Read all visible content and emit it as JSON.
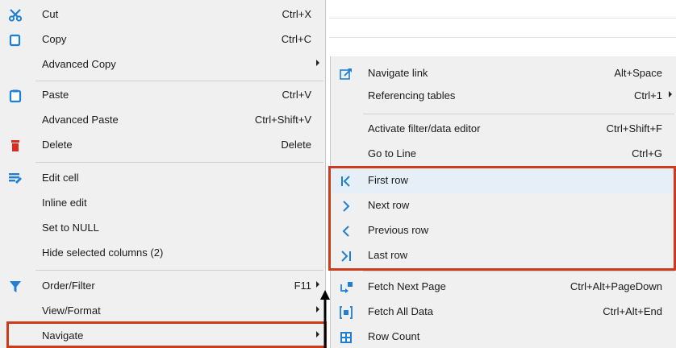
{
  "context_menu": {
    "items": [
      {
        "label": "Cut",
        "shortcut": "Ctrl+X",
        "icon": "scissors-icon"
      },
      {
        "label": "Copy",
        "shortcut": "Ctrl+C",
        "icon": "copy-icon"
      },
      {
        "label": "Advanced Copy",
        "shortcut": "",
        "icon": "",
        "submenu": true
      },
      {
        "label": "Paste",
        "shortcut": "Ctrl+V",
        "icon": "clipboard-icon"
      },
      {
        "label": "Advanced Paste",
        "shortcut": "Ctrl+Shift+V",
        "icon": ""
      },
      {
        "label": "Delete",
        "shortcut": "Delete",
        "icon": "trash-icon"
      },
      {
        "label": "Edit cell",
        "shortcut": "",
        "icon": "edit-cell-icon"
      },
      {
        "label": "Inline edit",
        "shortcut": "",
        "icon": ""
      },
      {
        "label": "Set to NULL",
        "shortcut": "",
        "icon": ""
      },
      {
        "label": "Hide selected columns (2)",
        "shortcut": "",
        "icon": ""
      },
      {
        "label": "Order/Filter",
        "shortcut": "F11",
        "icon": "filter-icon",
        "submenu": true
      },
      {
        "label": "View/Format",
        "shortcut": "",
        "icon": "",
        "submenu": true
      },
      {
        "label": "Navigate",
        "shortcut": "",
        "icon": "",
        "submenu": true
      }
    ]
  },
  "navigate_submenu": {
    "items": [
      {
        "label": "Navigate link",
        "shortcut": "Alt+Space",
        "icon": "navigate-link-icon"
      },
      {
        "label": "Referencing tables",
        "shortcut": "Ctrl+1",
        "icon": "",
        "submenu": true
      },
      {
        "label": "Activate filter/data editor",
        "shortcut": "Ctrl+Shift+F",
        "icon": ""
      },
      {
        "label": "Go to Line",
        "shortcut": "Ctrl+G",
        "icon": ""
      },
      {
        "label": "First row",
        "shortcut": "",
        "icon": "first-row-icon"
      },
      {
        "label": "Next row",
        "shortcut": "",
        "icon": "next-row-icon"
      },
      {
        "label": "Previous row",
        "shortcut": "",
        "icon": "previous-row-icon"
      },
      {
        "label": "Last row",
        "shortcut": "",
        "icon": "last-row-icon"
      },
      {
        "label": "Fetch Next Page",
        "shortcut": "Ctrl+Alt+PageDown",
        "icon": "fetch-next-page-icon"
      },
      {
        "label": "Fetch All Data",
        "shortcut": "Ctrl+Alt+End",
        "icon": "fetch-all-data-icon"
      },
      {
        "label": "Row Count",
        "shortcut": "",
        "icon": "row-count-icon"
      }
    ]
  },
  "colors": {
    "menu_bg": "#f0f0f0",
    "highlight_border": "#cc3b1c",
    "icon_blue": "#1e7fd6",
    "icon_red": "#d92c1c"
  }
}
